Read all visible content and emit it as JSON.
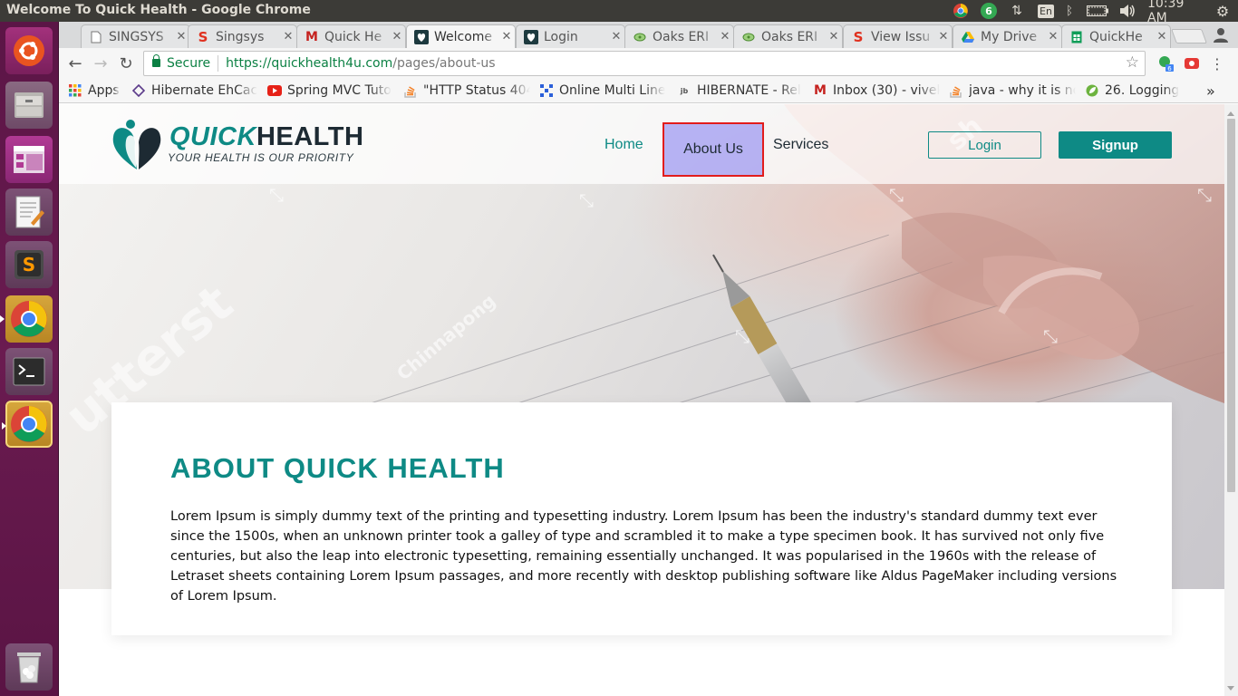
{
  "window": {
    "title": "Welcome To Quick Health - Google Chrome"
  },
  "tray": {
    "chrome_badge": "6",
    "keyboard": "En",
    "clock": "10:39 AM"
  },
  "launcher": {
    "items": [
      "ubuntu-dash",
      "files",
      "workspace-switcher",
      "text-editor",
      "sublime-text",
      "chrome",
      "terminal",
      "chrome-active",
      "trash"
    ]
  },
  "tabs": [
    {
      "label": "SINGSYS",
      "icon": "doc-icon"
    },
    {
      "label": "Singsys",
      "icon": "s-icon"
    },
    {
      "label": "Quick He",
      "icon": "gmail-icon"
    },
    {
      "label": "Welcome",
      "icon": "quickhealth-icon",
      "active": true
    },
    {
      "label": "Login",
      "icon": "quickhealth-icon"
    },
    {
      "label": "Oaks ERI",
      "icon": "oaks-icon"
    },
    {
      "label": "Oaks ERI",
      "icon": "oaks-icon"
    },
    {
      "label": "View Issu",
      "icon": "s-icon"
    },
    {
      "label": "My Drive",
      "icon": "drive-icon"
    },
    {
      "label": "QuickHe",
      "icon": "sheets-icon"
    }
  ],
  "omnibox": {
    "secure": "Secure",
    "url_main": "https://quickhealth4u.com",
    "url_path": "/pages/about-us"
  },
  "extension_badge": "6",
  "bookmarks": [
    {
      "label": "Apps",
      "icon": "apps-icon"
    },
    {
      "label": "Hibernate EhCac",
      "icon": "bookmark-icon"
    },
    {
      "label": "Spring MVC Tuto",
      "icon": "youtube-icon"
    },
    {
      "label": "\"HTTP Status 404",
      "icon": "stackoverflow-icon"
    },
    {
      "label": "Online Multi Line",
      "icon": "grid-icon"
    },
    {
      "label": "HIBERNATE - Rel",
      "icon": "jboss-icon"
    },
    {
      "label": "Inbox (30) - vivek",
      "icon": "gmail-icon"
    },
    {
      "label": "java - why it is no",
      "icon": "stackoverflow-icon"
    },
    {
      "label": "26. Logging",
      "icon": "spring-icon"
    }
  ],
  "bookmarks_overflow": "»",
  "site": {
    "logo_quick": "QUICK",
    "logo_health": "HEALTH",
    "tagline": "YOUR HEALTH IS OUR PRIORITY",
    "nav": {
      "home": "Home",
      "about": "About Us",
      "services": "Services"
    },
    "login": "Login",
    "signup": "Signup",
    "about_title": "ABOUT QUICK HEALTH",
    "about_text": "Lorem Ipsum is simply dummy text of the printing and typesetting industry. Lorem Ipsum has been the industry's standard dummy text ever since the 1500s, when an unknown printer took a galley of type and scrambled it to make a type specimen book. It has survived not only five centuries, but also the leap into electronic typesetting, remaining essentially unchanged. It was popularised in the 1960s with the release of Letraset sheets containing Lorem Ipsum passages, and more recently with desktop publishing software like Aldus PageMaker including versions of Lorem Ipsum."
  },
  "colors": {
    "brand_teal": "#0e8a85",
    "launcher_purple": "#5e1649",
    "highlight_box": "#e21c1c"
  }
}
